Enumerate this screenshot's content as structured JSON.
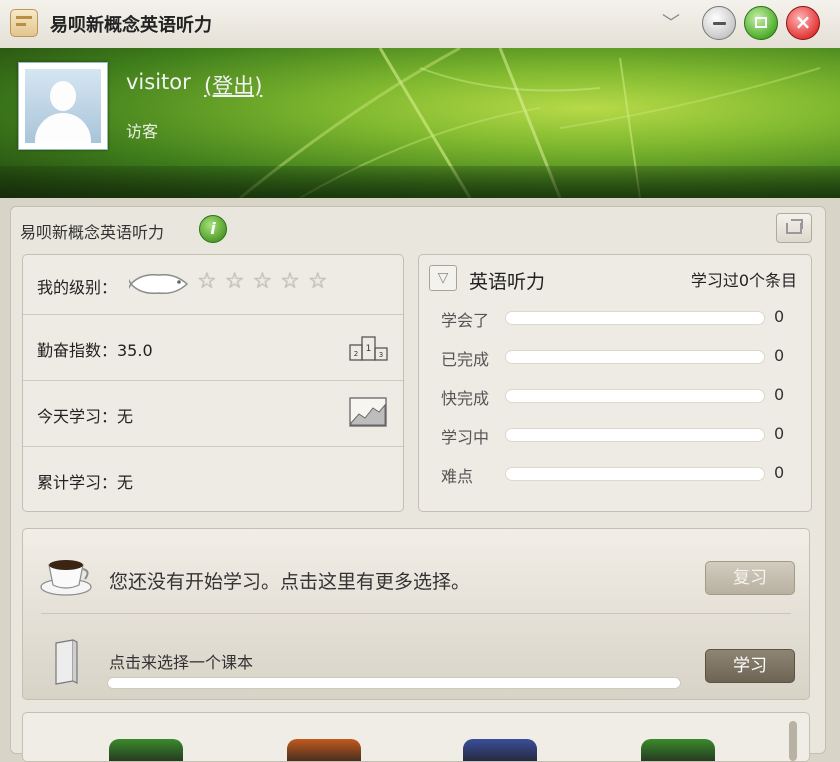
{
  "window": {
    "title": "易呗新概念英语听力",
    "icons": [
      "app-icon",
      "dropdown-icon",
      "minimize-icon",
      "maximize-icon",
      "close-icon"
    ]
  },
  "user": {
    "name": "visitor",
    "logout": "(登出)",
    "role": "访客"
  },
  "app": {
    "subtitle": "易呗新概念英语听力"
  },
  "stats": {
    "level_label": "我的级别：",
    "stars": "☆☆☆☆☆",
    "diligence": "勤奋指数：35.0",
    "today": "今天学习：无",
    "total": "累计学习：无"
  },
  "listening": {
    "title": "英语听力",
    "count": "学习过0个条目",
    "items": [
      {
        "label": "学会了",
        "value": "0",
        "progress": 0
      },
      {
        "label": "已完成",
        "value": "0",
        "progress": 0
      },
      {
        "label": "快完成",
        "value": "0",
        "progress": 0
      },
      {
        "label": "学习中",
        "value": "0",
        "progress": 0
      },
      {
        "label": "难点",
        "value": "0",
        "progress": 0
      }
    ]
  },
  "actions": {
    "status": "您还没有开始学习。点击这里有更多选择。",
    "review_button": "复习",
    "choose_text": "点击来选择一个课本",
    "study_button": "学习",
    "course_progress": 0
  },
  "colors": {
    "banner_green": "#7fb82f",
    "book_colors": [
      "#3c8a2c",
      "#c25a1e",
      "#3b4d9a",
      "#3c8a2c"
    ]
  }
}
